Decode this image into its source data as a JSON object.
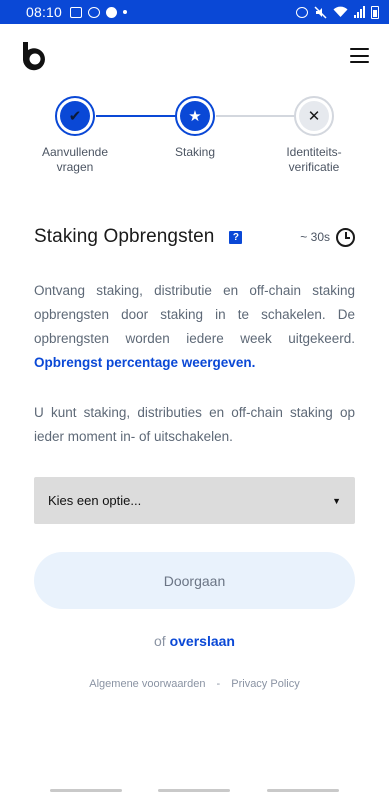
{
  "status_bar": {
    "time": "08:10",
    "left_icons": [
      "gallery-icon",
      "cloud-icon",
      "sync-icon",
      "dot-icon"
    ],
    "right_icons": [
      "alarm-icon",
      "mute-icon",
      "wifi-icon",
      "signal-icon",
      "battery-icon"
    ]
  },
  "header": {
    "logo_icon": "bitvavo-logo-icon",
    "menu_icon": "hamburger-icon"
  },
  "stepper": {
    "steps": [
      {
        "label_line1": "Aanvullende",
        "label_line2": "vragen",
        "state": "done",
        "symbol": "✔"
      },
      {
        "label_line1": "Staking",
        "label_line2": "",
        "state": "active",
        "symbol": "★"
      },
      {
        "label_line1": "Identiteits-",
        "label_line2": "verificatie",
        "state": "pending",
        "symbol": "✕"
      }
    ]
  },
  "section": {
    "title": "Staking Opbrengsten",
    "help_symbol": "?",
    "duration": "~ 30s",
    "paragraph1": "Ontvang staking, distributie en off-chain staking opbrengsten door staking in te schakelen. De opbrengsten worden iedere week uitgekeerd.",
    "paragraph1_link": "Opbrengst percentage weergeven.",
    "paragraph2": "U kunt staking, distributies en off-chain staking op ieder moment in- of uitschakelen."
  },
  "select": {
    "placeholder": "Kies een optie...",
    "caret": "▼"
  },
  "actions": {
    "continue_label": "Doorgaan",
    "skip_prefix": "of",
    "skip_label": "overslaan"
  },
  "footer": {
    "terms": "Algemene voorwaarden",
    "separator": "-",
    "privacy": "Privacy Policy"
  },
  "colors": {
    "accent": "#0a48d6",
    "status_bar": "#0a48d6",
    "select_bg": "#dcdcdc",
    "button_bg": "#e9f2fc",
    "muted_text": "#5e6977"
  }
}
